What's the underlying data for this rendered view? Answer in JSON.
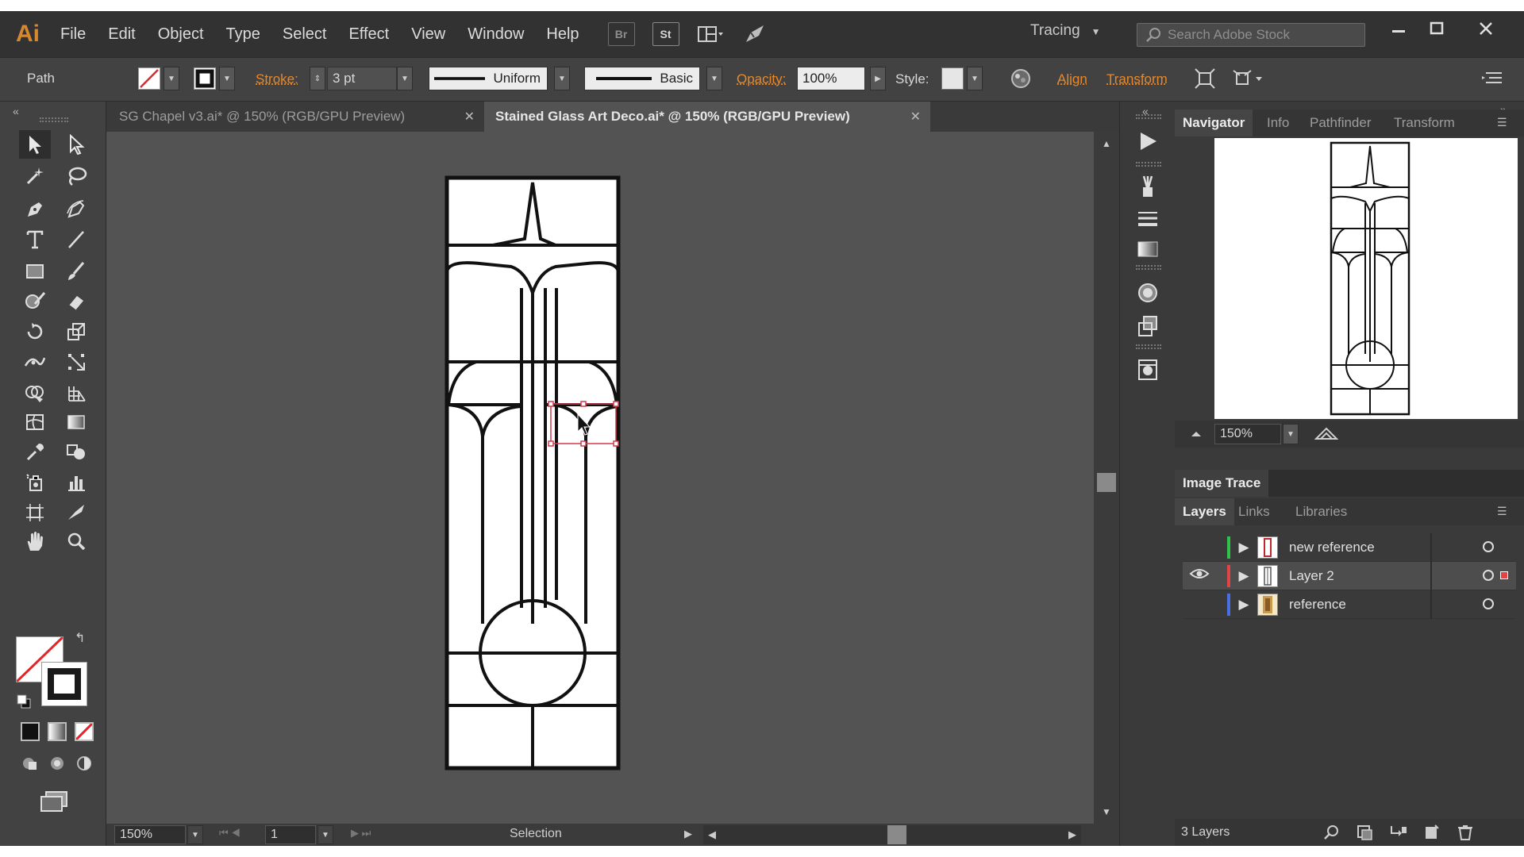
{
  "app": {
    "logo": "Ai",
    "menu": [
      "File",
      "Edit",
      "Object",
      "Type",
      "Select",
      "Effect",
      "View",
      "Window",
      "Help"
    ],
    "bridge_button": "Br",
    "stock_button": "St",
    "workspace": "Tracing",
    "search_placeholder": "Search Adobe Stock"
  },
  "control_bar": {
    "selection_type": "Path",
    "stroke_label": "Stroke:",
    "stroke_weight": "3 pt",
    "profile": "Uniform",
    "brush": "Basic",
    "opacity_label": "Opacity:",
    "opacity": "100%",
    "style_label": "Style:",
    "align": "Align",
    "transform": "Transform"
  },
  "documents": [
    {
      "title": "SG Chapel v3.ai* @ 150% (RGB/GPU Preview)",
      "active": false
    },
    {
      "title": "Stained Glass Art Deco.ai* @ 150% (RGB/GPU Preview)",
      "active": true
    }
  ],
  "status_bar": {
    "zoom": "150%",
    "artboard": "1",
    "tool": "Selection"
  },
  "panels": {
    "top_tabs": [
      "Navigator",
      "Info",
      "Pathfinder",
      "Transform"
    ],
    "navigator_zoom": "150%",
    "image_trace": "Image Trace",
    "layer_tabs": [
      "Layers",
      "Links",
      "Libraries"
    ],
    "layers": [
      {
        "name": "new reference",
        "color": "#2ec24a",
        "visible": false,
        "selected": false
      },
      {
        "name": "Layer 2",
        "color": "#e04545",
        "visible": true,
        "selected": true
      },
      {
        "name": "reference",
        "color": "#4a6de0",
        "visible": false,
        "selected": false
      }
    ],
    "layer_count": "3 Layers"
  },
  "colors": {
    "accent": "#e6892c",
    "selection": "#d03a4e"
  }
}
